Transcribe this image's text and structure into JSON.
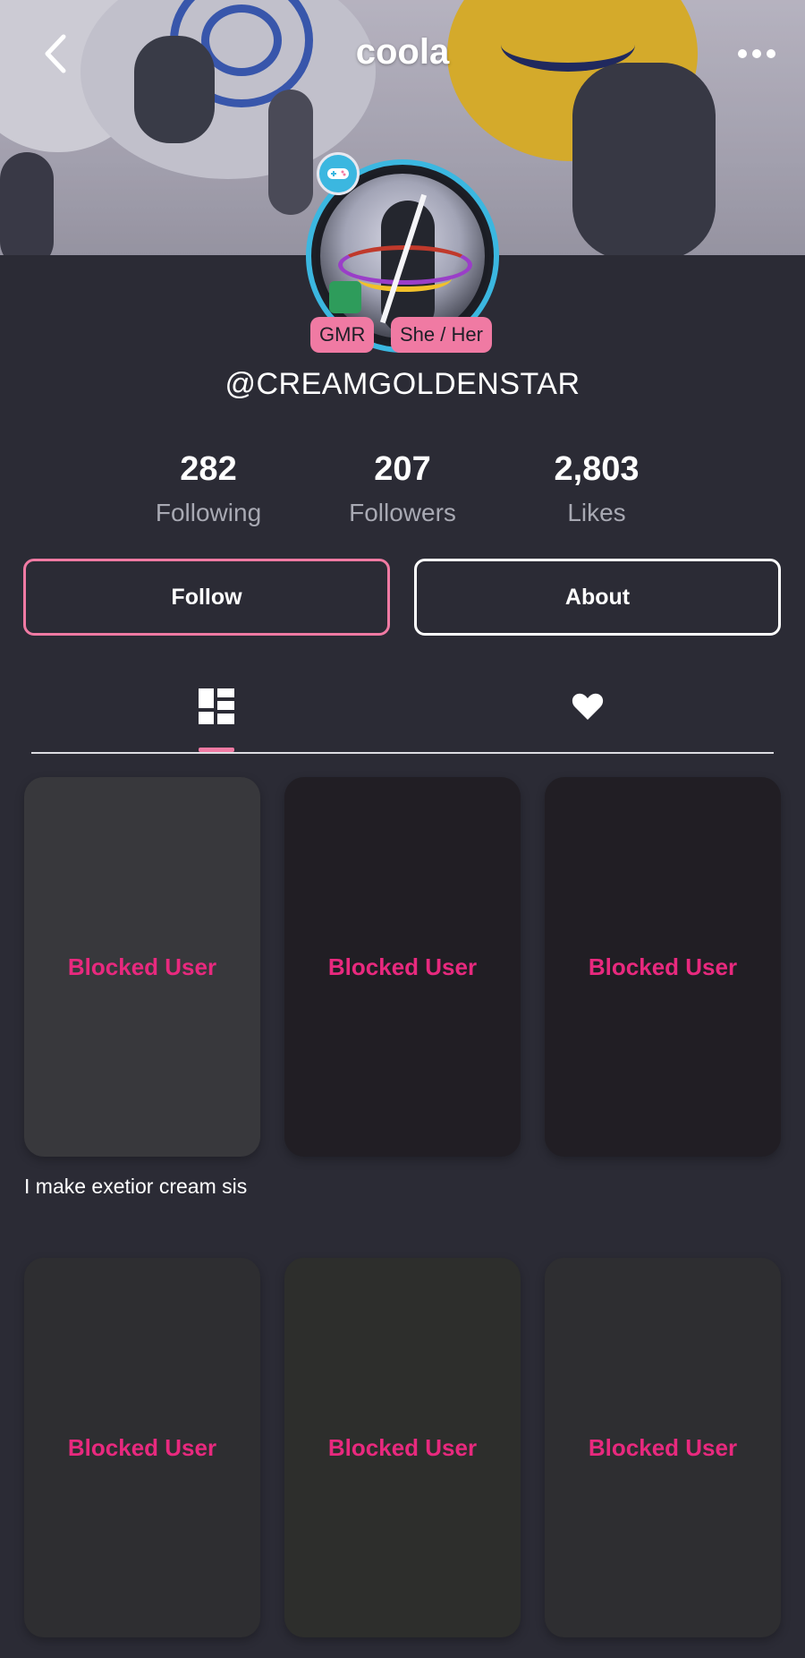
{
  "header": {
    "title": "coola",
    "back_icon": "chevron-left-icon",
    "more_icon": "ellipsis-icon"
  },
  "profile": {
    "tags": [
      "GMR",
      "She / Her"
    ],
    "handle": "@CREAMGOLDENSTAR",
    "accent_color": "#f07aa3"
  },
  "stats": {
    "following": {
      "value": "282",
      "label": "Following"
    },
    "followers": {
      "value": "207",
      "label": "Followers"
    },
    "likes": {
      "value": "2,803",
      "label": "Likes"
    }
  },
  "actions": {
    "follow_label": "Follow",
    "about_label": "About"
  },
  "tabs": {
    "items": [
      "grid-icon",
      "heart-icon"
    ],
    "active": "grid-icon"
  },
  "posts": [
    {
      "label": "Blocked User",
      "caption": "I make exetior cream sis"
    },
    {
      "label": "Blocked User",
      "caption": ""
    },
    {
      "label": "Blocked User",
      "caption": ""
    },
    {
      "label": "Blocked User",
      "caption": ""
    },
    {
      "label": "Blocked User",
      "caption": ""
    },
    {
      "label": "Blocked User",
      "caption": ""
    }
  ],
  "colors": {
    "background": "#2b2b35",
    "blocked_text": "#e8297e",
    "avatar_ring": "#3bb7e0"
  }
}
